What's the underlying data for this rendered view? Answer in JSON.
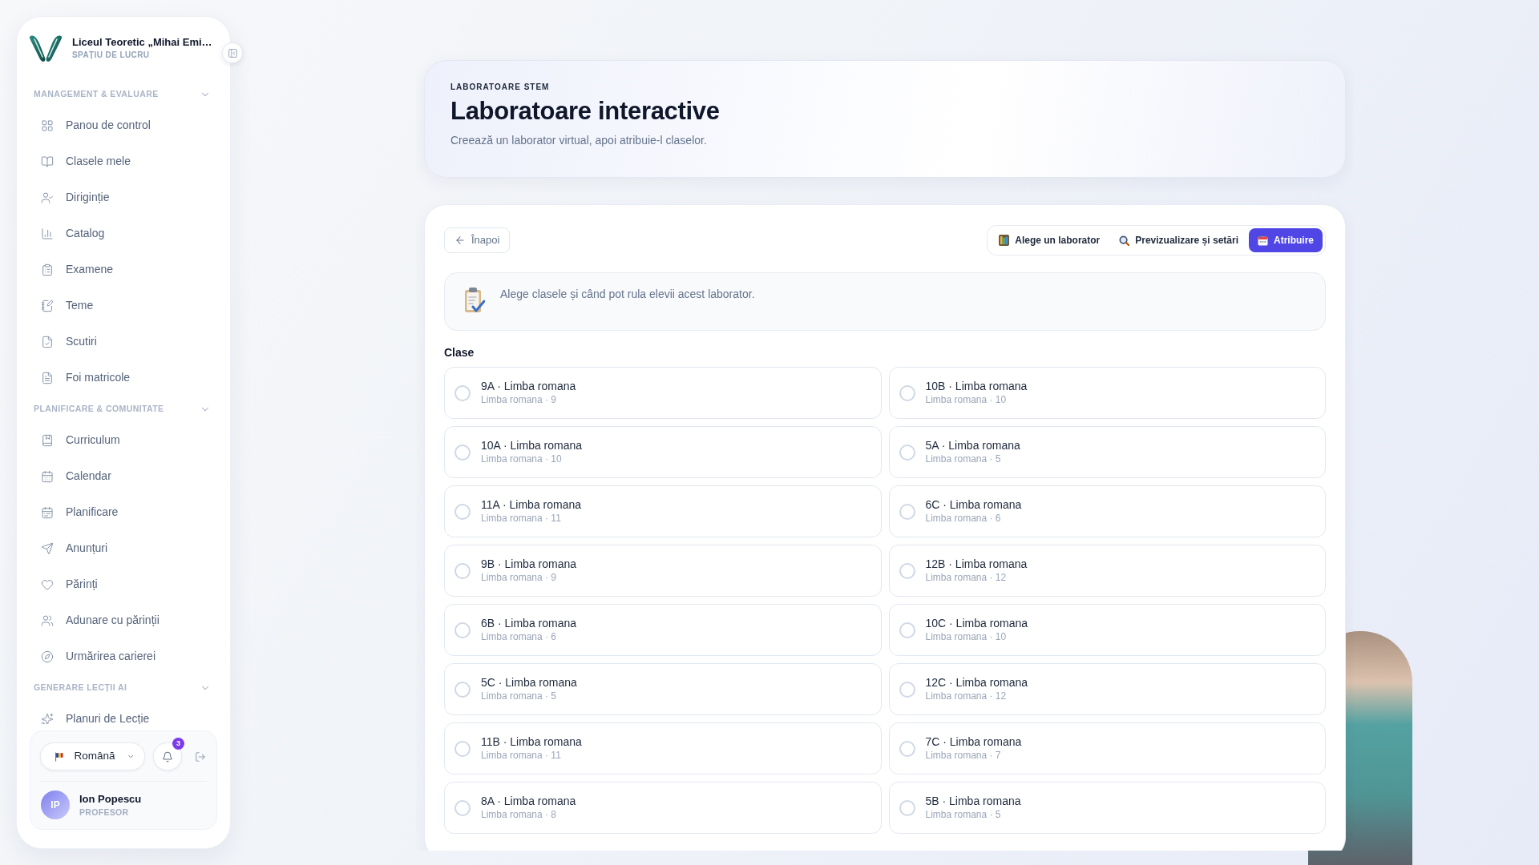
{
  "sidebar": {
    "workspace": {
      "name": "Liceul Teoretic „Mihai Emi…",
      "label": "SPAȚIU DE LUCRU"
    },
    "sections": [
      {
        "title": "MANAGEMENT & EVALUARE",
        "expanded": true,
        "items": [
          {
            "label": "Panou de control",
            "selected": false
          },
          {
            "label": "Clasele mele",
            "selected": false
          },
          {
            "label": "Diriginție",
            "selected": false
          },
          {
            "label": "Catalog",
            "selected": false
          },
          {
            "label": "Examene",
            "selected": false
          },
          {
            "label": "Teme",
            "selected": false
          },
          {
            "label": "Scutiri",
            "selected": false
          },
          {
            "label": "Foi matricole",
            "selected": false
          }
        ]
      },
      {
        "title": "PLANIFICARE & COMUNITATE",
        "expanded": true,
        "items": [
          {
            "label": "Curriculum",
            "selected": false
          },
          {
            "label": "Calendar",
            "selected": false
          },
          {
            "label": "Planificare",
            "selected": false
          },
          {
            "label": "Anunțuri",
            "selected": false
          },
          {
            "label": "Părinți",
            "selected": false
          },
          {
            "label": "Adunare cu părinții",
            "selected": false
          },
          {
            "label": "Urmărirea carierei",
            "selected": false
          }
        ]
      },
      {
        "title": "GENERARE LECȚII AI",
        "expanded": true,
        "items": [
          {
            "label": "Planuri de Lecție",
            "selected": false
          }
        ]
      }
    ],
    "footer": {
      "language": "Română",
      "notification_count": "3",
      "user": {
        "initials": "IP",
        "name": "Ion Popescu",
        "role": "PROFESOR"
      }
    }
  },
  "header": {
    "eyebrow": "LABORATOARE STEM",
    "title": "Laboratoare interactive",
    "subtitle": "Creează un laborator virtual, apoi atribuie-l claselor."
  },
  "wizard": {
    "back_button": "Înapoi",
    "steps": [
      {
        "label": "Alege un laborator",
        "selected": false
      },
      {
        "label": "Previzualizare și setări",
        "selected": false
      },
      {
        "label": "Atribuire",
        "selected": true
      }
    ],
    "hint": "Alege clasele și când pot rula elevii acest laborator.",
    "classes_label": "Clase",
    "classes": [
      {
        "title": "9A · Limba romana",
        "details": "Limba romana · 9",
        "checked": false
      },
      {
        "title": "10B · Limba romana",
        "details": "Limba romana · 10",
        "checked": false
      },
      {
        "title": "10A · Limba romana",
        "details": "Limba romana · 10",
        "checked": false
      },
      {
        "title": "5A · Limba romana",
        "details": "Limba romana · 5",
        "checked": false
      },
      {
        "title": "11A · Limba romana",
        "details": "Limba romana · 11",
        "checked": false
      },
      {
        "title": "6C · Limba romana",
        "details": "Limba romana · 6",
        "checked": false
      },
      {
        "title": "9B · Limba romana",
        "details": "Limba romana · 9",
        "checked": false
      },
      {
        "title": "12B · Limba romana",
        "details": "Limba romana · 12",
        "checked": false
      },
      {
        "title": "6B · Limba romana",
        "details": "Limba romana · 6",
        "checked": false
      },
      {
        "title": "10C · Limba romana",
        "details": "Limba romana · 10",
        "checked": false
      },
      {
        "title": "5C · Limba romana",
        "details": "Limba romana · 5",
        "checked": false
      },
      {
        "title": "12C · Limba romana",
        "details": "Limba romana · 12",
        "checked": false
      },
      {
        "title": "11B · Limba romana",
        "details": "Limba romana · 11",
        "checked": false
      },
      {
        "title": "7C · Limba romana",
        "details": "Limba romana · 7",
        "checked": false
      },
      {
        "title": "8A · Limba romana",
        "details": "Limba romana · 8",
        "checked": false
      },
      {
        "title": "5B · Limba romana",
        "details": "Limba romana · 5",
        "checked": false
      }
    ]
  }
}
